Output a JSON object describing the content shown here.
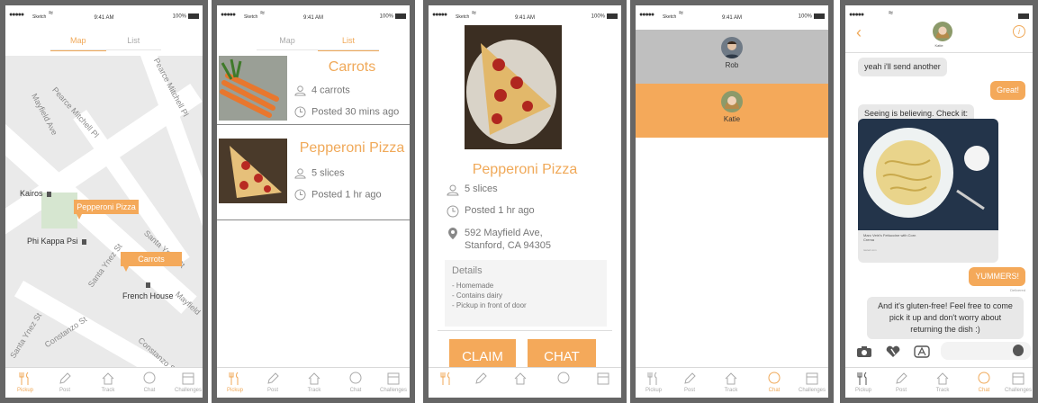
{
  "status": {
    "carrier": "Sketch",
    "time": "9:41 AM",
    "battery": "100%"
  },
  "tabs": {
    "map": "Map",
    "list": "List"
  },
  "tabbar": {
    "pickup": "Pickup",
    "post": "Post",
    "track": "Track",
    "chat": "Chat",
    "challenges": "Challenges"
  },
  "map": {
    "streets": [
      "Mayfield Ave",
      "Pearce Mitchell Pl",
      "Pearce Mitchell Pl",
      "Santa Ynez St",
      "Constanzo St",
      "Santa Ynez St",
      "Constanzo St",
      "Santa Ynez St",
      "Mayfield"
    ],
    "places": [
      "Kairos",
      "Phi Kappa Psi",
      "French House"
    ],
    "pins": [
      "Pepperoni Pizza",
      "Carrots"
    ]
  },
  "list": {
    "items": [
      {
        "title": "Carrots",
        "qty": "4 carrots",
        "posted": "Posted 30 mins ago"
      },
      {
        "title": "Pepperoni Pizza",
        "qty": "5 slices",
        "posted": "Posted 1 hr ago"
      }
    ]
  },
  "detail": {
    "title": "Pepperoni Pizza",
    "qty": "5 slices",
    "posted": "Posted 1 hr ago",
    "address_line1": "592 Mayfield Ave,",
    "address_line2": "Stanford, CA 94305",
    "details_heading": "Details",
    "details": [
      "- Homemade",
      "- Contains dairy",
      "- Pickup in front of door"
    ],
    "claim": "CLAIM",
    "chat": "CHAT"
  },
  "contacts": [
    {
      "name": "Rob"
    },
    {
      "name": "Katie"
    }
  ],
  "conversation": {
    "name": "Katie",
    "messages": [
      {
        "dir": "in",
        "text": "yeah i'll send another"
      },
      {
        "dir": "out",
        "text": "Great!"
      },
      {
        "dir": "in",
        "text": "Seeing is believing. Check it:"
      },
      {
        "dir": "out",
        "text": "YUMMERS!"
      },
      {
        "dir": "in",
        "text": "And it's gluten-free! Feel free to come pick it up and don't worry about returning the dish :)"
      }
    ],
    "photo_caption": "Marc Vetri's Fettuccine with Corn Crema",
    "photo_source": "tasted.com",
    "delivered": "Delivered"
  },
  "colors": {
    "accent": "#f4a95a",
    "selected_row": "#f4a95a",
    "unselected_row": "#bfbfbf"
  },
  "icons": [
    "back-icon",
    "info-icon",
    "camera-icon",
    "heart-icon",
    "appstore-icon",
    "mic-icon",
    "person-icon",
    "clock-icon",
    "location-pin-icon",
    "fork-knife-icon",
    "pencil-icon",
    "house-icon",
    "chat-bubble-icon",
    "calendar-icon"
  ]
}
